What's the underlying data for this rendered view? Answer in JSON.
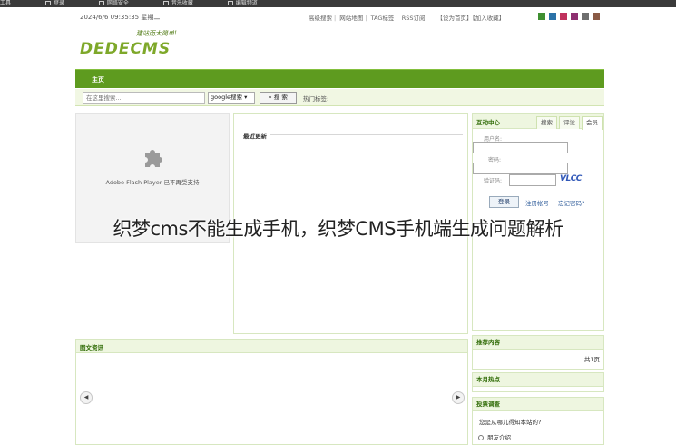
{
  "browser": {
    "bookmarks": [
      "工具",
      "登录",
      "网络安全",
      "音乐收藏",
      "编辑频道"
    ]
  },
  "header": {
    "datetime": "2024/6/6 09:35:35 星期二",
    "links": [
      "高级搜索",
      "网站地图",
      "TAG标签",
      "RSS订阅"
    ],
    "right_links": "【设为首页】【加入收藏】",
    "color_swatches": [
      "#3f8f31",
      "#2b72a8",
      "#c0325d",
      "#8e2f70",
      "#6e6e6e",
      "#8a5a45"
    ]
  },
  "logo": {
    "text": "DEDECMS",
    "slogan": "建站而大简单!"
  },
  "nav": {
    "home": "主页"
  },
  "search": {
    "placeholder": "在这里搜索...",
    "engine": "google搜索",
    "button": "搜 索",
    "hot_label": "热门标签:"
  },
  "flash": {
    "message": "Adobe Flash Player 已不再受支持"
  },
  "latest": {
    "title": "最近更新"
  },
  "member": {
    "title": "互动中心",
    "tabs": [
      "搜索",
      "评论",
      "会员"
    ],
    "username_label": "用户名:",
    "password_label": "密码:",
    "vcode_label": "验证码:",
    "vcode_image": "VLCC",
    "login_button": "登录",
    "register": "注册帐号",
    "forgot": "忘记密码?"
  },
  "news": {
    "title": "图文资讯",
    "prev_icon": "◀",
    "next_icon": "▶"
  },
  "recommend": {
    "title": "推荐内容",
    "count": "共1页"
  },
  "hot_month": {
    "title": "本月热点"
  },
  "survey": {
    "title": "投票调查",
    "question": "您是从哪儿得知本站的?",
    "option1": "朋友介绍"
  },
  "overlay": {
    "caption": "织梦cms不能生成手机，织梦CMS手机端生成问题解析"
  }
}
